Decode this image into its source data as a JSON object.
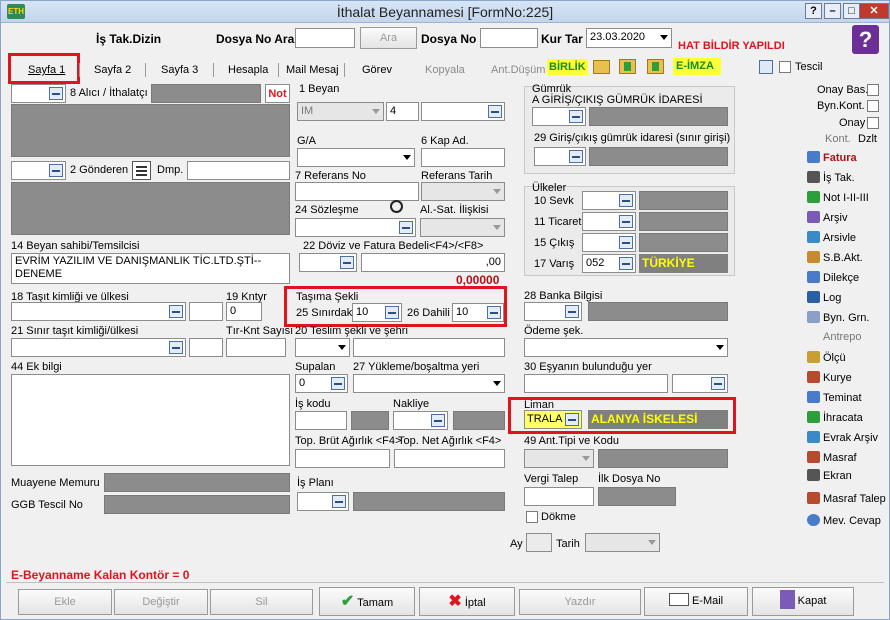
{
  "window": {
    "title": "İthalat Beyannamesi [FormNo:225]",
    "app_badge": "ETH"
  },
  "header": {
    "is_takip_label": "İş Tak.Dizin",
    "dosya_no_ara_label": "Dosya No Ara",
    "ara_button": "Ara",
    "dosya_no_label": "Dosya No",
    "kur_tar_label": "Kur Tar",
    "kur_tar_value": "23.03.2020",
    "hat_bildir": "HAT BİLDİR YAPILDI"
  },
  "tabs": [
    {
      "label": "Sayfa 1"
    },
    {
      "label": "Sayfa 2"
    },
    {
      "label": "Sayfa 3"
    },
    {
      "label": "Hesapla"
    },
    {
      "label": "Mail Mesaj"
    },
    {
      "label": "Görev"
    },
    {
      "label": "Kopyala"
    },
    {
      "label": "Ant.Düşüm"
    }
  ],
  "toolbar": {
    "birlik": "BİRLİK",
    "e_imza": "E-İMZA",
    "tescil": "Tescil"
  },
  "fields": {
    "alici": "8 Alıcı / İthalatçı",
    "not_badge": "Not",
    "beyan": "1 Beyan",
    "beyan_type": "IM",
    "beyan_num": "4",
    "gumruk": "Gümrük",
    "giris_cikis": "A GİRİŞ/ÇIKIŞ GÜMRÜK İDARESİ",
    "gonderen": "2 Gönderen",
    "dmp": "Dmp.",
    "ga": "G/A",
    "kap_ad": "6 Kap Ad.",
    "giris_cikis_sinir": "29 Giriş/çıkış gümrük idaresi (sınır girişi)",
    "referans_no": "7 Referans No",
    "referans_tarih": "Referans Tarih",
    "ulkeler": "Ülkeler",
    "sevk": "10 Sevk",
    "sozlesme": "24 Sözleşme",
    "al_sat": "Al.-Sat. İlişkisi",
    "ticaret": "11 Ticaret",
    "cikis": "15 Çıkış",
    "varis": "17 Varış",
    "varis_code": "052",
    "varis_name": "TÜRKİYE",
    "beyan_sahibi": "14 Beyan sahibi/Temsilcisi",
    "beyan_sahibi_value": "EVRİM YAZILIM VE DANIŞMANLIK TİC.LTD.ŞTİ--DENEME",
    "doviz": "22 Döviz ve Fatura Bedeli<F4>/<F8>",
    "doviz_value": ",00",
    "total": "0,00000",
    "tasit_kimligi": "18 Taşıt kimliği ve ülkesi",
    "kntyr": "19 Kntyr",
    "kntyr_value": "0",
    "tasima_sekli": "Taşıma Şekli",
    "sinirdaki": "25 Sınırdaki",
    "sinirdaki_value": "10",
    "dahili": "26 Dahili",
    "dahili_value": "10",
    "banka": "28 Banka Bilgisi",
    "sinir_tasit": "21 Sınır taşıt kimliği/ülkesi",
    "tir_knt": "Tır-Knt Sayısı",
    "teslim": "20 Teslim şekli ve şehri",
    "odeme": "Ödeme şek.",
    "ek_bilgi": "44 Ek bilgi",
    "supalan": "Supalan",
    "supalan_value": "0",
    "yukleme": "27 Yükleme/boşaltma yeri",
    "esya_yeri": "30 Eşyanın bulunduğu yer",
    "is_kodu": "İş kodu",
    "nakliye": "Nakliye",
    "liman": "Liman",
    "liman_code": "TRALA",
    "liman_name": "ALANYA İSKELESİ",
    "brut": "Top. Brüt Ağırlık <F4>",
    "net": "Top. Net Ağırlık <F4>",
    "ant_tipi": "49 Ant.Tipi ve Kodu",
    "muayene": "Muayene Memuru",
    "vergi_talep": "Vergi Talep",
    "ilk_dosya": "İlk Dosya No",
    "ggb": "GGB Tescil No",
    "is_plani": "İş Planı",
    "dokme": "Dökme",
    "ay": "Ay",
    "tarih": "Tarih",
    "kontor": "E-Beyanname Kalan Kontör = 0"
  },
  "sidebar": {
    "onay_bas": "Onay Bas.",
    "byn_kont": "Byn.Kont.",
    "onay": "Onay",
    "kont": "Kont.",
    "dzlt": "Dzlt",
    "items": [
      "Fatura",
      "İş Tak.",
      "Not I-II-III",
      "Arşiv",
      "Arsivle",
      "S.B.Akt.",
      "Dilekçe",
      "Log",
      "Byn. Grn.",
      "Antrepo",
      "Ölçü",
      "Kurye",
      "Teminat",
      "İhracata",
      "Evrak Arşiv",
      "Masraf",
      "Ekran",
      "Masraf Talep",
      "Mev. Cevap"
    ]
  },
  "footer": {
    "ekle": "Ekle",
    "degistir": "Değiştir",
    "sil": "Sil",
    "tamam": "Tamam",
    "iptal": "İptal",
    "yazdir": "Yazdır",
    "email": "E-Mail",
    "kapat": "Kapat"
  }
}
